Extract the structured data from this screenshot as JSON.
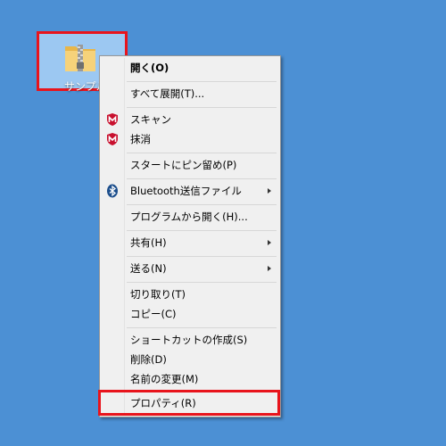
{
  "desktop": {
    "icon": {
      "label": "サンプル",
      "icon_name": "zip-folder-icon"
    }
  },
  "context_menu": {
    "items": [
      {
        "label": "開く(O)",
        "bold": true,
        "submenu": false,
        "icon": null
      },
      {
        "label": "すべて展開(T)...",
        "submenu": false,
        "icon": null
      },
      {
        "label": "スキャン",
        "submenu": false,
        "icon": "mcafee-shield-icon"
      },
      {
        "label": "抹消",
        "submenu": false,
        "icon": "mcafee-shield-icon"
      },
      {
        "label": "スタートにピン留め(P)",
        "submenu": false,
        "icon": null
      },
      {
        "label": "Bluetooth送信ファイル",
        "submenu": true,
        "icon": "bluetooth-icon"
      },
      {
        "label": "プログラムから開く(H)...",
        "submenu": false,
        "icon": null
      },
      {
        "label": "共有(H)",
        "submenu": true,
        "icon": null
      },
      {
        "label": "送る(N)",
        "submenu": true,
        "icon": null
      },
      {
        "label": "切り取り(T)",
        "submenu": false,
        "icon": null
      },
      {
        "label": "コピー(C)",
        "submenu": false,
        "icon": null
      },
      {
        "label": "ショートカットの作成(S)",
        "submenu": false,
        "icon": null
      },
      {
        "label": "削除(D)",
        "submenu": false,
        "icon": null
      },
      {
        "label": "名前の変更(M)",
        "submenu": false,
        "icon": null
      },
      {
        "label": "プロパティ(R)",
        "submenu": false,
        "icon": null
      }
    ]
  },
  "colors": {
    "desktop_bg": "#4c90d4",
    "highlight": "#e8141c",
    "menu_bg": "#f0f0f0"
  }
}
